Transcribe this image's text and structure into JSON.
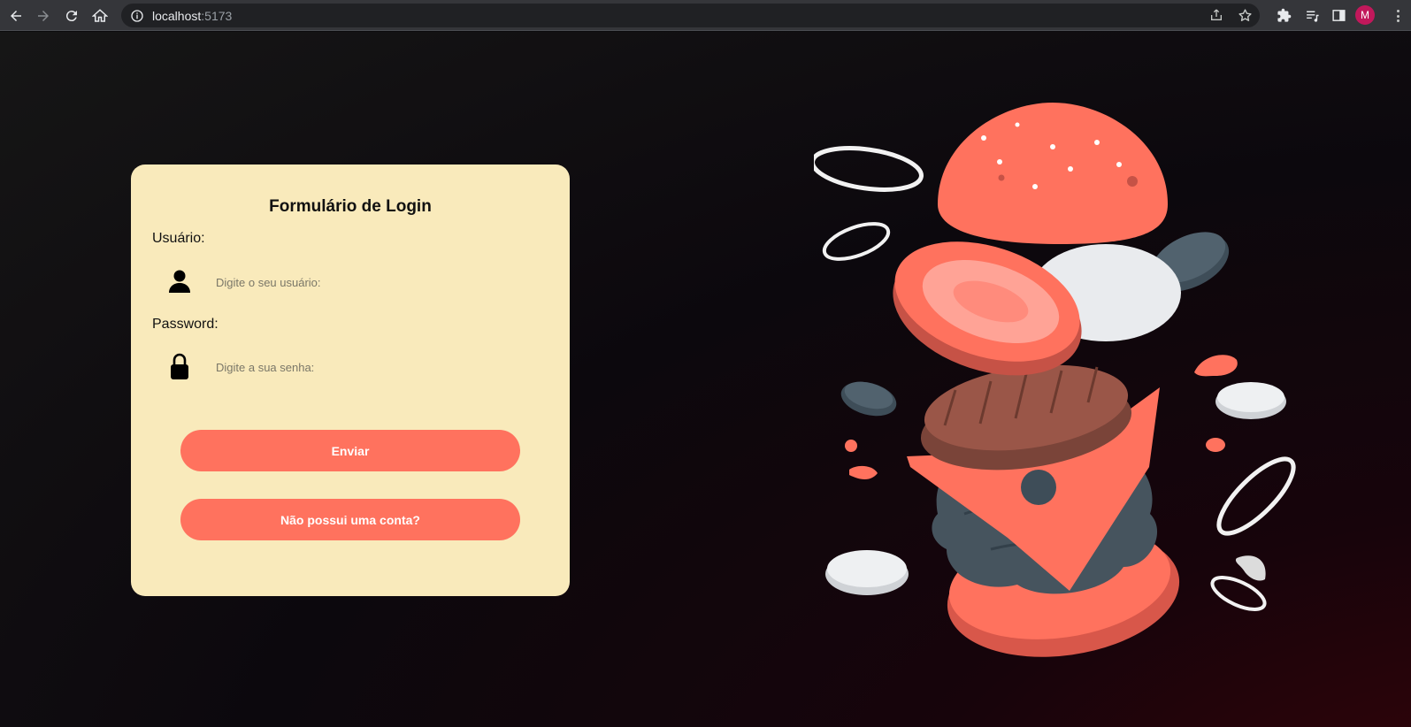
{
  "browser": {
    "url_host": "localhost",
    "url_port": ":5173",
    "profile_initial": "M"
  },
  "login": {
    "title": "Formulário de Login",
    "user_label": "Usuário:",
    "user_placeholder": "Digite o seu usuário:",
    "password_label": "Password:",
    "password_placeholder": "Digite a sua senha:",
    "submit_label": "Enviar",
    "signup_label": "Não possui uma conta?"
  },
  "colors": {
    "card_bg": "#f9eabb",
    "accent": "#ff725e",
    "chrome_bg": "#35363a"
  },
  "icons": [
    "back-arrow-icon",
    "forward-arrow-icon",
    "reload-icon",
    "home-icon",
    "info-icon",
    "share-icon",
    "star-icon",
    "extensions-icon",
    "media-icon",
    "side-panel-icon",
    "user-icon",
    "lock-icon"
  ]
}
